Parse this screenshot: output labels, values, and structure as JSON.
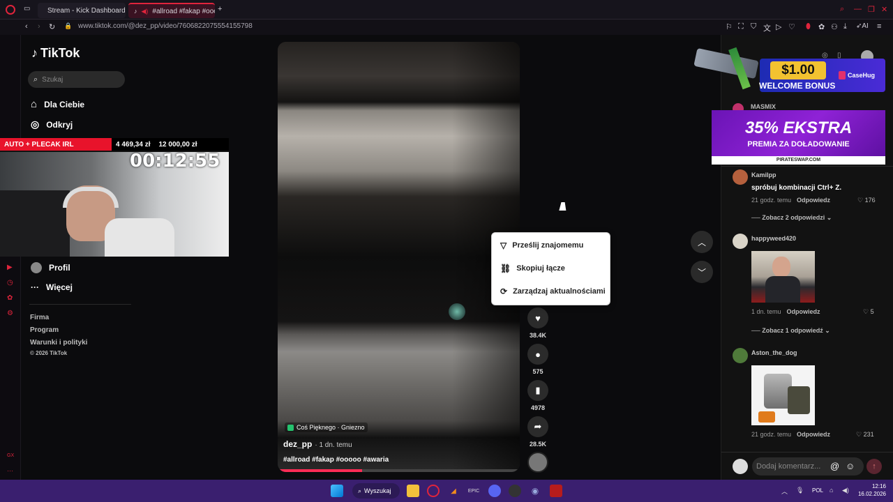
{
  "browser": {
    "tabs": [
      {
        "label": "Stream - Kick Dashboard"
      },
      {
        "label": "#allroad #fakap #oooo"
      }
    ],
    "url": "www.tiktok.com/@dez_pp/video/7606822075554155798",
    "ai_label": "AI"
  },
  "tiktok": {
    "logo": "TikTok",
    "search_placeholder": "Szukaj",
    "nav": [
      {
        "label": "Dla Ciebie"
      },
      {
        "label": "Odkryj"
      },
      {
        "label": "Profil"
      },
      {
        "label": "Więcej"
      }
    ],
    "footer": [
      "Firma",
      "Program",
      "Warunki i polityki",
      "© 2026 TikTok"
    ]
  },
  "stream_overlay": {
    "title": "AUTO + PLECAK IRL",
    "amount_current": "4 469,34 zł",
    "amount_goal": "12 000,00 zł",
    "timer": "00:12:55"
  },
  "video": {
    "location": "Coś Pięknego · Gniezno",
    "author": "dez_pp",
    "time": "· 1 dn. temu",
    "hashtags": "#allroad #fakap #ooooo #awaria",
    "likes": "38.4K",
    "comments": "575",
    "saves": "4978",
    "shares": "28.5K"
  },
  "share_menu": {
    "items": [
      "Prześlij znajomemu",
      "Skopiuj łącze",
      "Zarządzaj aktualnościami"
    ]
  },
  "ads": {
    "casehug_amount": "$1.00",
    "casehug_text": "WELCOME BONUS",
    "casehug_brand": "CaseHug",
    "pirate_headline": "35% EKSTRA",
    "pirate_sub": "PREMIA ZA DOŁADOWANIE",
    "pirate_domain": "PIRATESWAP.COM"
  },
  "comments": {
    "partial_name": "MASMIX",
    "items": [
      {
        "name": "Kamilpp",
        "text": "spróbuj kombinacji Ctrl+ Z.",
        "time": "21 godz. temu",
        "reply": "Odpowiedz",
        "likes": "176",
        "more": "Zobacz 2 odpowiedzi"
      },
      {
        "name": "happyweed420",
        "time": "1 dn. temu",
        "reply": "Odpowiedz",
        "likes": "5",
        "more": "Zobacz 1 odpowiedź"
      },
      {
        "name": "Aston_the_dog",
        "time": "21 godz. temu",
        "reply": "Odpowiedz",
        "likes": "231"
      }
    ],
    "input_placeholder": "Dodaj komentarz..."
  },
  "taskbar": {
    "search": "Wyszukaj",
    "lang": "POL",
    "time": "12:16",
    "date": "16.02.2026"
  },
  "colors": {
    "accent": "#fe2c55",
    "taskbar": "#3a1f6f",
    "overlay_red": "#e8132b"
  }
}
